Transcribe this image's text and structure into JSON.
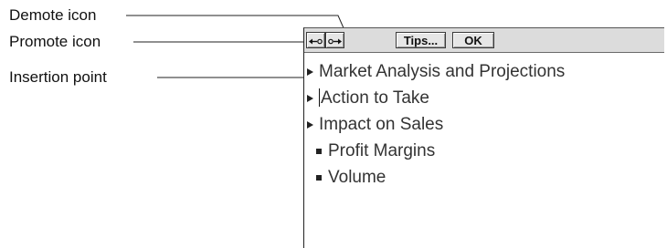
{
  "callouts": {
    "demote": "Demote icon",
    "promote": "Promote icon",
    "insertion_point": "Insertion point"
  },
  "toolbar": {
    "demote_icon": "demote-arrow-icon",
    "promote_icon": "promote-arrow-icon",
    "tips_label": "Tips...",
    "ok_label": "OK"
  },
  "outline": {
    "items": [
      {
        "level": 1,
        "text": "Market Analysis and Projections"
      },
      {
        "level": 1,
        "text": "Action to Take"
      },
      {
        "level": 1,
        "text": "Impact on Sales"
      },
      {
        "level": 2,
        "text": "Profit Margins"
      },
      {
        "level": 2,
        "text": "Volume"
      }
    ]
  }
}
